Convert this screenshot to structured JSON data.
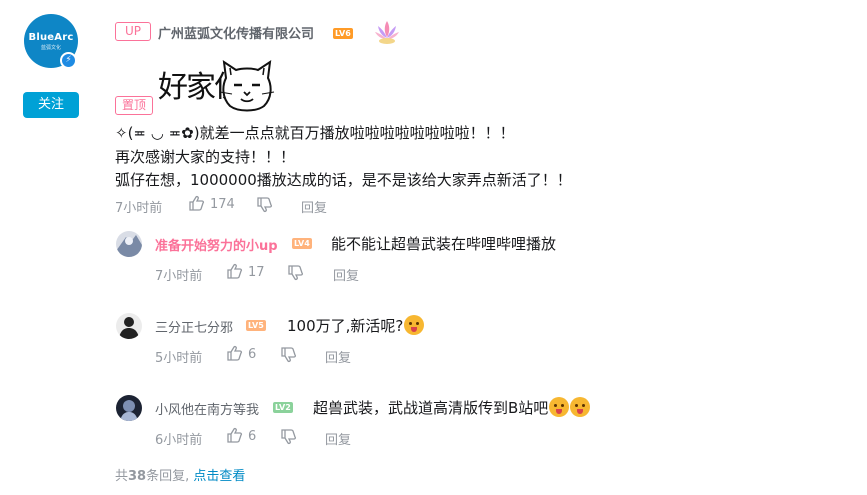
{
  "author": {
    "avatar_brand": "BlueArc",
    "avatar_sub": "蓝弧文化",
    "follow_label": "关注",
    "up_badge": "UP",
    "name": "广州蓝弧文化传播有限公司",
    "level": "LV6"
  },
  "main_comment": {
    "pinned_label": "置顶",
    "sticker_text": "好家伙",
    "lines": [
      "✧(≖ ◡ ≖✿)就差一点点就百万播放啦啦啦啦啦啦啦啦！！！",
      "再次感谢大家的支持！！！",
      "弧仔在想，1000000播放达成的话，是不是该给大家弄点新活了！！"
    ],
    "time": "7小时前",
    "likes": "174",
    "reply_label": "回复"
  },
  "replies": [
    {
      "name": "准备开始努力的小up",
      "name_color": "#fb7299",
      "level": "LV4",
      "text": "能不能让超兽武装在哔哩哔哩播放",
      "time": "7小时前",
      "likes": "17",
      "reply_label": "回复"
    },
    {
      "name": "三分正七分邪",
      "name_color": "#61666d",
      "level": "LV5",
      "text": "100万了,新活呢?",
      "time": "5小时前",
      "likes": "6",
      "reply_label": "回复"
    },
    {
      "name": "小风他在南方等我",
      "name_color": "#61666d",
      "level": "LV2",
      "text": "超兽武装，武战道高清版传到B站吧",
      "time": "6小时前",
      "likes": "6",
      "reply_label": "回复"
    }
  ],
  "footer": {
    "prefix": "共",
    "count": "38",
    "suffix": "条回复,",
    "link": "点击查看"
  },
  "colors": {
    "accent": "#00a1d6",
    "pink": "#fb7299",
    "link": "#008ac5",
    "meta": "#9499a0"
  }
}
